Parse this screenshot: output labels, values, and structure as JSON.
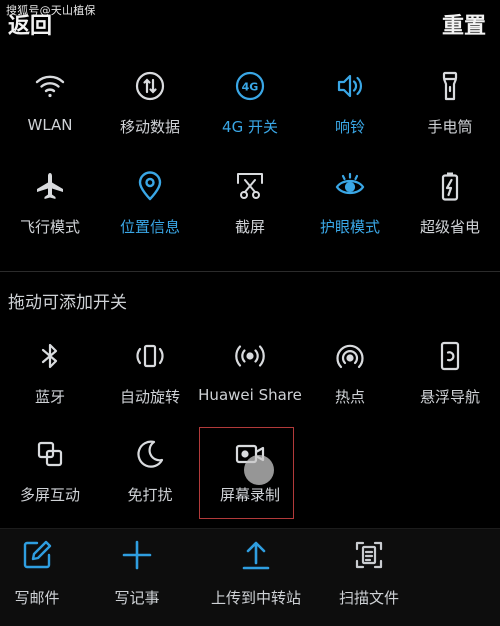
{
  "watermark": "搜狐号@天山植保",
  "header": {
    "back_label": "返回",
    "reset_label": "重置"
  },
  "active_tiles": {
    "row1": [
      {
        "label": "WLAN",
        "icon": "wifi-icon",
        "on": false
      },
      {
        "label": "移动数据",
        "icon": "mobile-data-icon",
        "on": false
      },
      {
        "label": "4G 开关",
        "icon": "4g-icon",
        "on": true
      },
      {
        "label": "响铃",
        "icon": "ringer-icon",
        "on": true
      },
      {
        "label": "手电筒",
        "icon": "flashlight-icon",
        "on": false
      }
    ],
    "row2": [
      {
        "label": "飞行模式",
        "icon": "airplane-icon",
        "on": false
      },
      {
        "label": "位置信息",
        "icon": "location-icon",
        "on": true
      },
      {
        "label": "截屏",
        "icon": "screenshot-icon",
        "on": false
      },
      {
        "label": "护眼模式",
        "icon": "eye-comfort-icon",
        "on": true
      },
      {
        "label": "超级省电",
        "icon": "battery-saver-icon",
        "on": false
      }
    ]
  },
  "drag_section": {
    "title": "拖动可添加开关",
    "row1": [
      {
        "label": "蓝牙",
        "icon": "bluetooth-icon"
      },
      {
        "label": "自动旋转",
        "icon": "auto-rotate-icon"
      },
      {
        "label": "Huawei Share",
        "icon": "huawei-share-icon"
      },
      {
        "label": "热点",
        "icon": "hotspot-icon"
      },
      {
        "label": "悬浮导航",
        "icon": "floating-nav-icon"
      }
    ],
    "row2": [
      {
        "label": "多屏互动",
        "icon": "multi-screen-icon"
      },
      {
        "label": "免打扰",
        "icon": "do-not-disturb-icon"
      },
      {
        "label": "屏幕录制",
        "icon": "screen-record-icon"
      }
    ]
  },
  "bottom_bar": [
    {
      "label": "写邮件",
      "icon": "compose-mail-icon"
    },
    {
      "label": "写记事",
      "icon": "new-note-icon"
    },
    {
      "label": "上传到中转站",
      "icon": "upload-icon"
    },
    {
      "label": "扫描文件",
      "icon": "scan-document-icon"
    }
  ],
  "colors": {
    "accent": "#3aa7e6",
    "highlight_border": "#b23a3a",
    "background": "#000000"
  }
}
